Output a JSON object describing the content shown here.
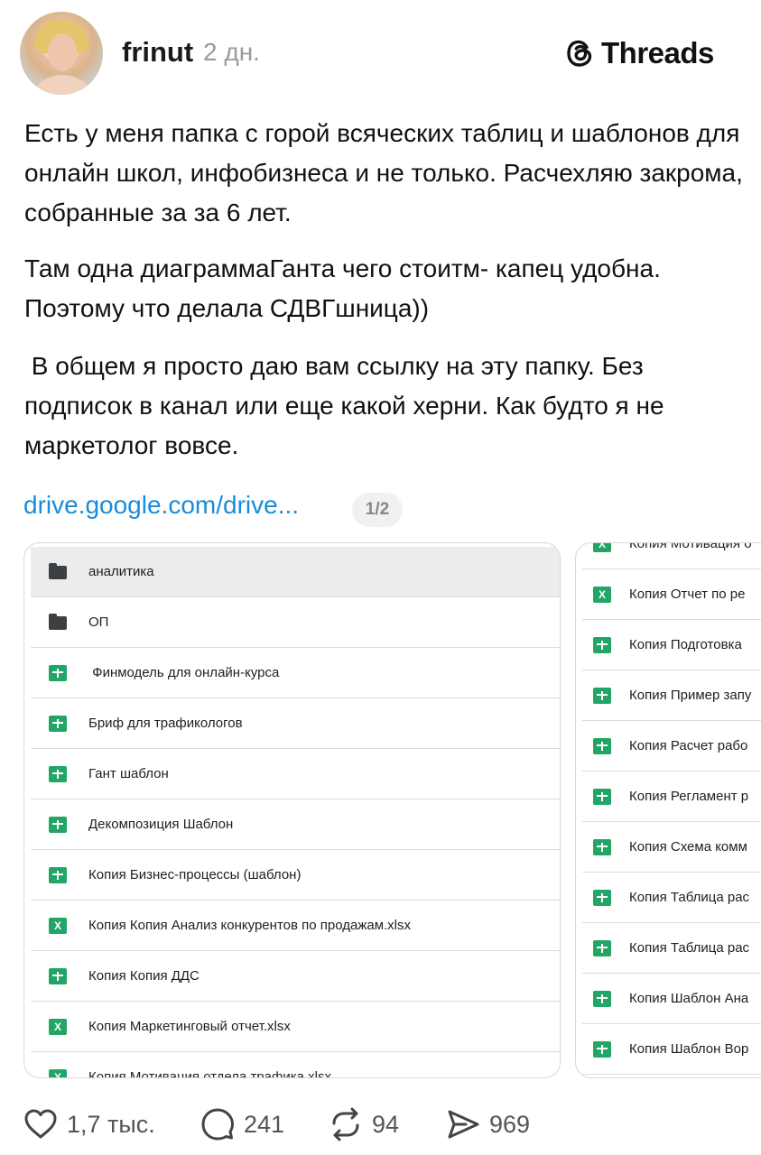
{
  "header": {
    "username": "frinut",
    "time": "2 дн.",
    "brand": "Threads",
    "icons": {
      "avatar": "avatar",
      "brand": "threads-logo-icon"
    }
  },
  "post": {
    "para1": "Есть у меня папка с горой всяческих таблиц и шаблонов для онлайн школ, инфобизнеса и не только. Расчехляю закрома, собранные за за 6 лет.",
    "para2": "Там одна диаграммаГанта чего стоитм- капец удобна.  Поэтому что делала СДВГшница))",
    "para3": " В общем я просто даю вам ссылку на эту папку. Без подписок в канал или еще какой херни. Как будто я не маркетолог вовсе."
  },
  "link": {
    "text": "drive.google.com/drive...",
    "pager": "1/2"
  },
  "card_left": {
    "rows": [
      {
        "name": "аналитика",
        "icon": "folder-icon"
      },
      {
        "name": "ОП",
        "icon": "folder-icon"
      },
      {
        "name": " Финмодель для онлайн-курса",
        "icon": "sheets-icon"
      },
      {
        "name": "Бриф для трафикологов",
        "icon": "sheets-icon"
      },
      {
        "name": "Гант шаблон",
        "icon": "sheets-icon"
      },
      {
        "name": "Декомпозиция Шаблон",
        "icon": "sheets-icon"
      },
      {
        "name": "Копия Бизнес-процессы (шаблон)",
        "icon": "sheets-icon"
      },
      {
        "name": "Копия Копия Анализ конкурентов по продажам.xlsx",
        "icon": "excel-icon"
      },
      {
        "name": "Копия Копия ДДС",
        "icon": "sheets-icon"
      },
      {
        "name": "Копия Маркетинговый отчет.xlsx",
        "icon": "excel-icon"
      },
      {
        "name": "Копия Мотивация отдела трафика.xlsx",
        "icon": "excel-icon"
      }
    ]
  },
  "card_right": {
    "rows": [
      {
        "name": "Копия Мотивация о",
        "icon": "excel-icon"
      },
      {
        "name": "Копия Отчет по ре",
        "icon": "excel-icon"
      },
      {
        "name": "Копия Подготовка",
        "icon": "sheets-icon"
      },
      {
        "name": "Копия Пример запу",
        "icon": "sheets-icon"
      },
      {
        "name": "Копия Расчет рабо",
        "icon": "sheets-icon"
      },
      {
        "name": "Копия Регламент р",
        "icon": "sheets-icon"
      },
      {
        "name": "Копия Схема комм",
        "icon": "sheets-icon"
      },
      {
        "name": "Копия Таблица рас",
        "icon": "sheets-icon"
      },
      {
        "name": "Копия Таблица рас",
        "icon": "sheets-icon"
      },
      {
        "name": "Копия Шаблон Ана",
        "icon": "sheets-icon"
      },
      {
        "name": "Копия Шаблон Вор",
        "icon": "sheets-icon"
      }
    ]
  },
  "actions": {
    "likes": "1,7 тыс.",
    "comments": "241",
    "reposts": "94",
    "shares": "969"
  },
  "colors": {
    "link": "#1a8cd8",
    "sheet_green": "#23a566",
    "text": "#111111",
    "muted": "#9a9a9a"
  }
}
